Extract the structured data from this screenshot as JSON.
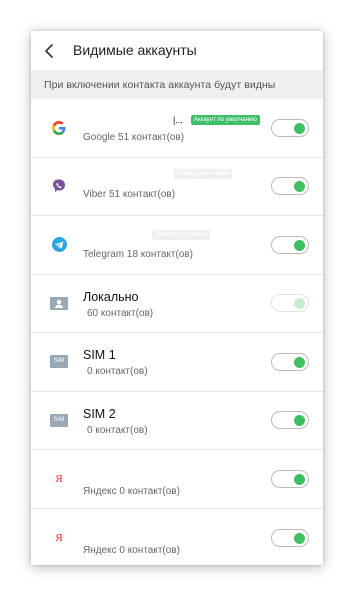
{
  "header": {
    "title": "Видимые аккаунты"
  },
  "subheader": {
    "text": "При включении контакта аккаунта будут видны"
  },
  "accounts": [
    {
      "icon": "google-icon",
      "primary": "",
      "secondary": "Google  51 контакт(ов)",
      "badge": "Аккаунт по умолчанию",
      "badge_partial": "|..."
    },
    {
      "icon": "viber-icon",
      "secondary": "Viber  51 контакт(ов)",
      "badge": "Только для чтения"
    },
    {
      "icon": "telegram-icon",
      "secondary": "Telegram  18 контакт(ов)",
      "badge": "Только для чтения"
    },
    {
      "icon": "local-contact-icon",
      "primary": "Локально",
      "secondary": "60 контакт(ов)",
      "disabled": true
    },
    {
      "icon": "sim-icon",
      "icon_text": "SIM",
      "primary": "SIM 1",
      "secondary": "0 контакт(ов)"
    },
    {
      "icon": "sim-icon",
      "icon_text": "SIM",
      "primary": "SIM 2",
      "secondary": "0 контакт(ов)"
    },
    {
      "icon": "yandex-icon",
      "icon_text": "Я",
      "secondary": "Яндекс  0 контакт(ов)"
    },
    {
      "icon": "yandex-icon",
      "icon_text": "Я",
      "secondary": "Яндекс  0 контакт(ов)"
    }
  ],
  "colors": {
    "accent": "#3cc063",
    "badge_green": "#3fbf6a",
    "sim_icon": "#9aa7b4",
    "yandex": "#e8262a"
  }
}
